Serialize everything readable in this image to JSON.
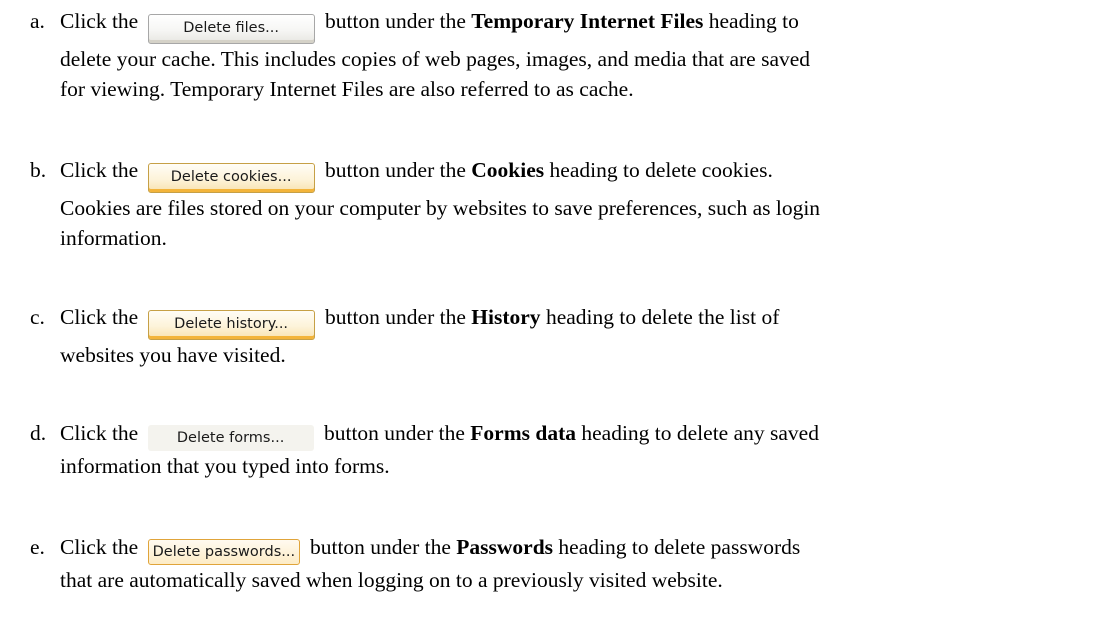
{
  "steps": [
    {
      "marker": "a.",
      "prefix": "Click the",
      "button": "Delete files...",
      "after_button": "button under the",
      "heading": "Temporary Internet Files",
      "rest_line1": "heading to",
      "line2": "delete your cache.  This includes copies of web pages, images, and media that are saved",
      "line3": "for viewing.  Temporary Internet Files are also referred to as cache."
    },
    {
      "marker": "b.",
      "prefix": "Click the",
      "button": "Delete cookies...",
      "after_button": "button under the",
      "heading": "Cookies",
      "rest_line1": "heading to delete cookies.",
      "line2": "Cookies are files stored on your computer by websites to save preferences, such as login",
      "line3": "information."
    },
    {
      "marker": "c.",
      "prefix": "Click the",
      "button": "Delete history...",
      "after_button": "button under the",
      "heading": "History",
      "rest_line1": "heading to delete the list of",
      "line2": "websites you have visited."
    },
    {
      "marker": "d.",
      "prefix": "Click the",
      "button": "Delete forms...",
      "after_button": "button under the",
      "heading": "Forms data",
      "rest_line1": "heading to delete any saved",
      "line2": "information that you typed into forms."
    },
    {
      "marker": "e.",
      "prefix": "Click the",
      "button": "Delete passwords...",
      "after_button": "button under the",
      "heading": "Passwords",
      "rest_line1": "heading to delete passwords",
      "line2": "that are automatically saved when logging on to a previously visited website."
    }
  ]
}
